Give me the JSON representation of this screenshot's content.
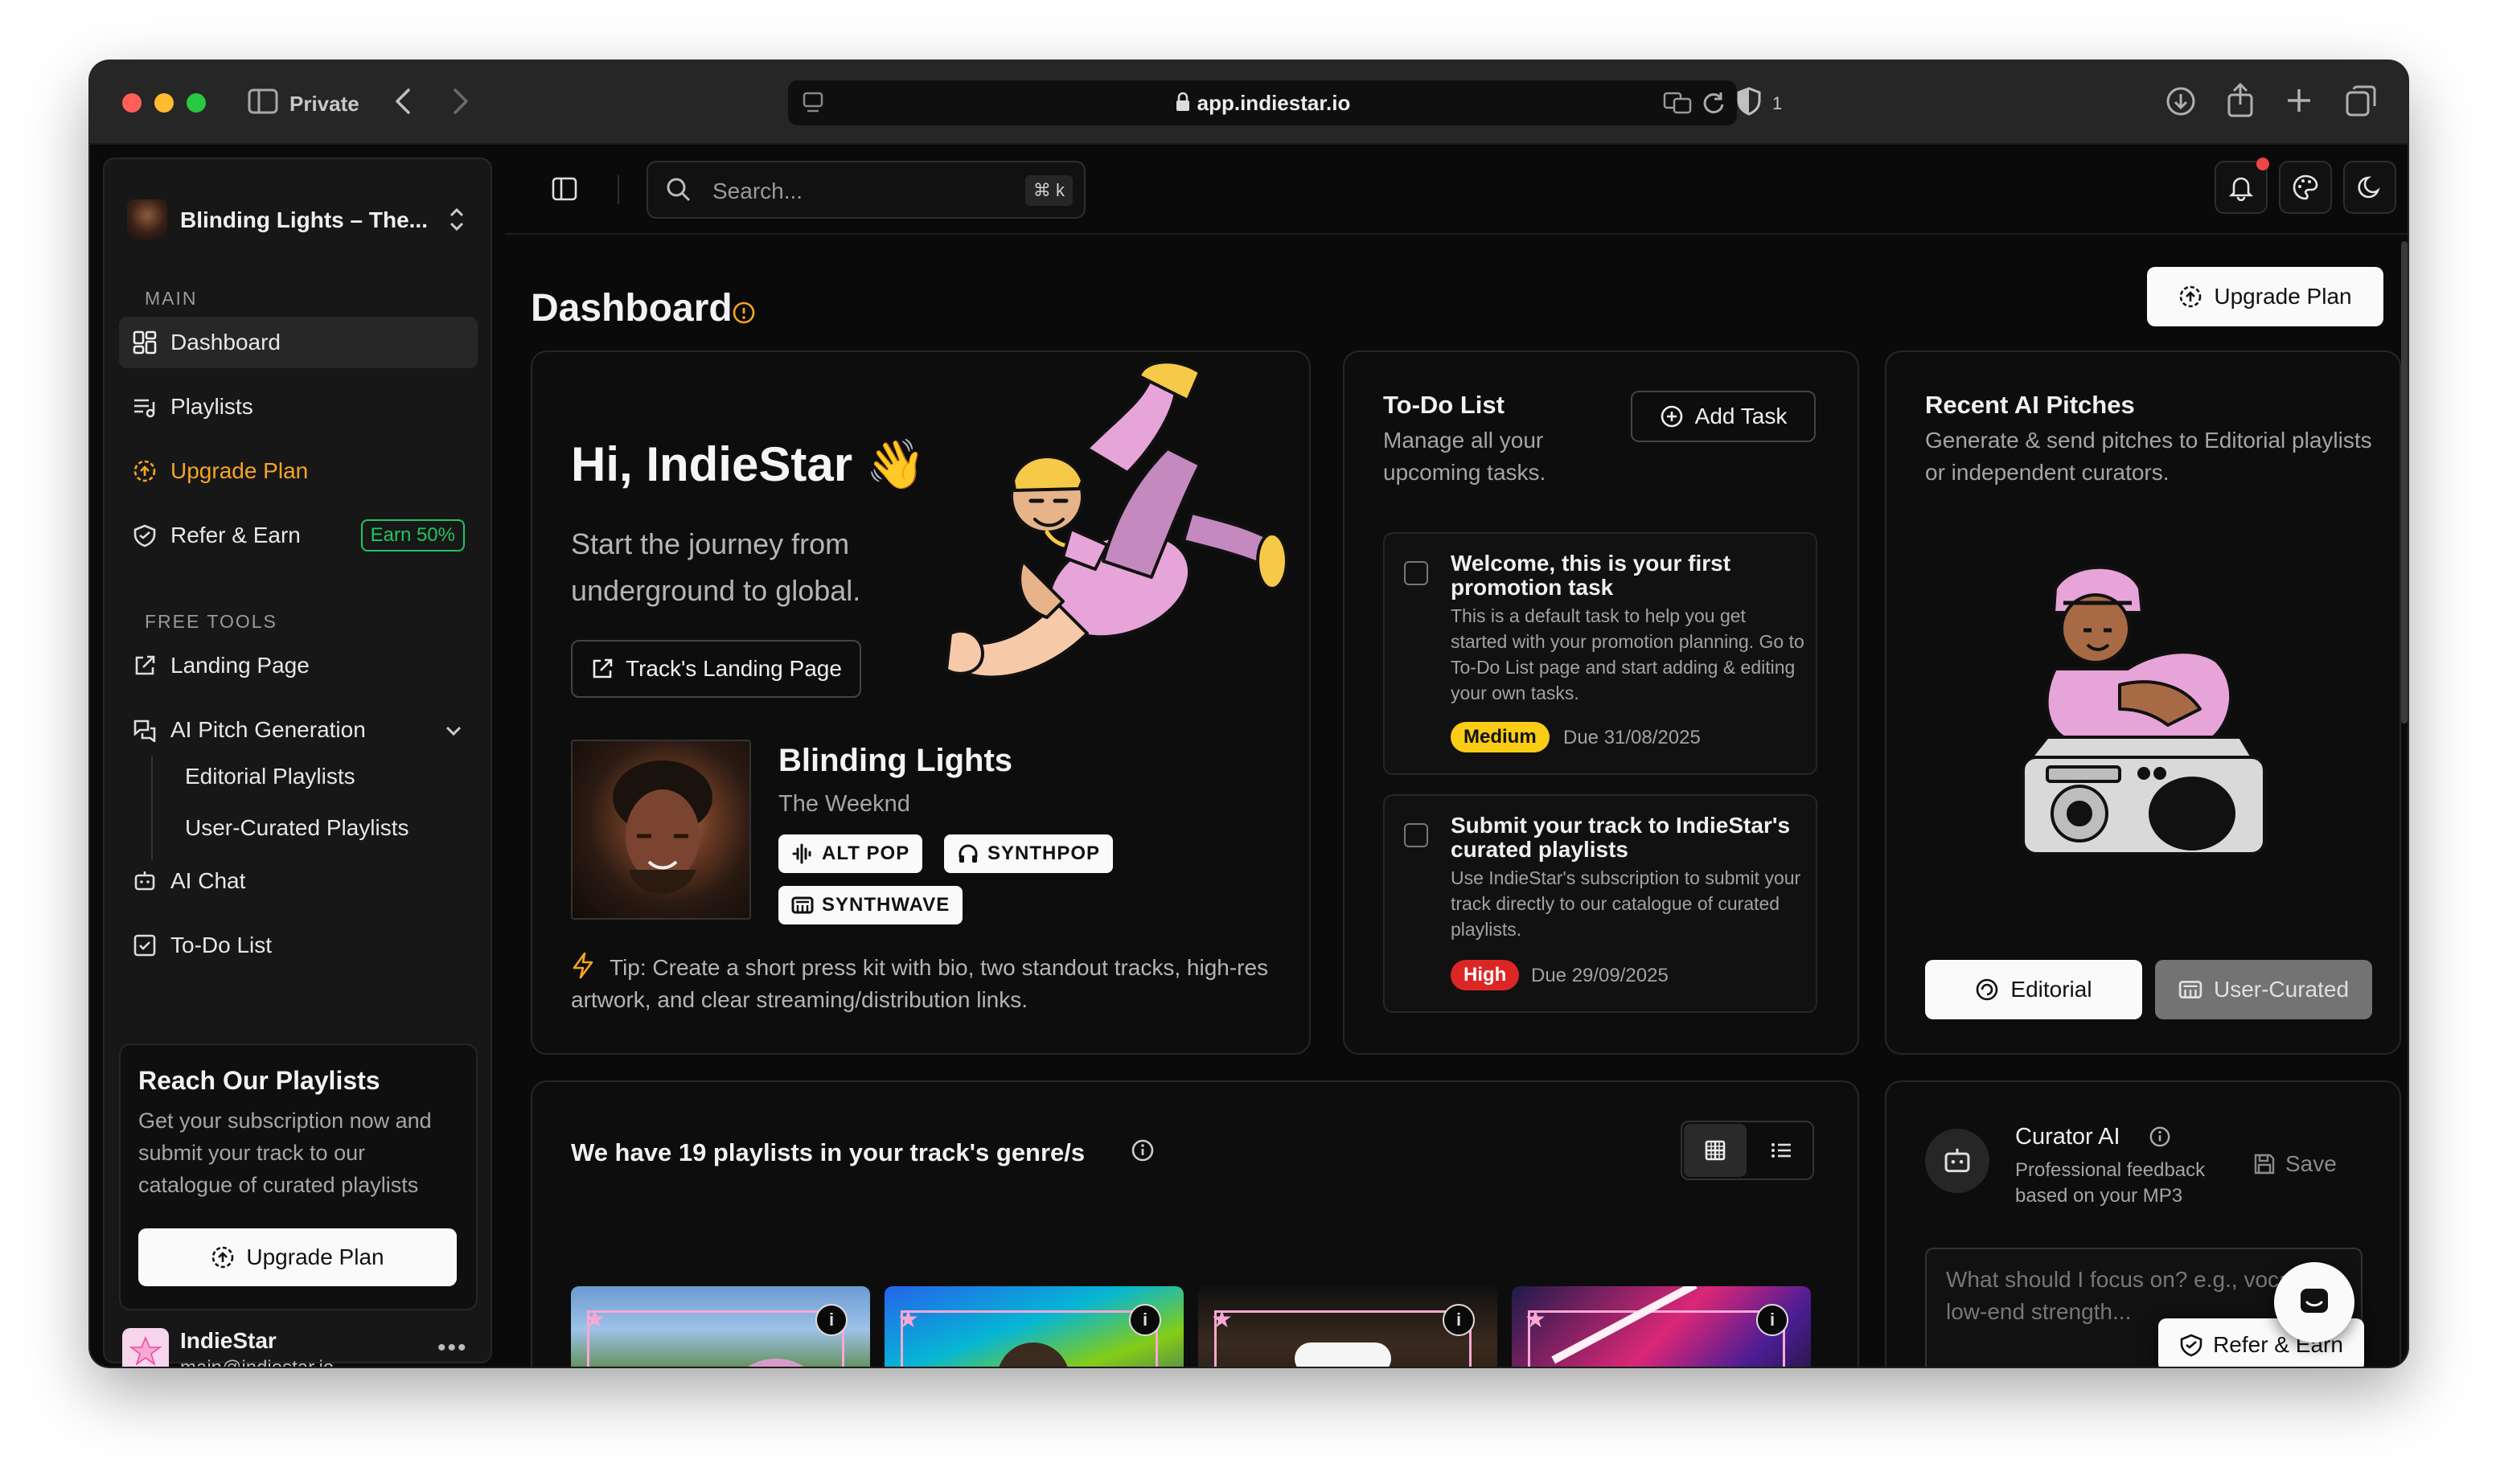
{
  "browser": {
    "private_label": "Private",
    "url": "app.indiestar.io",
    "shield_count": "1"
  },
  "sidebar": {
    "project_name": "Blinding Lights – The...",
    "section_main": "MAIN",
    "items_main": [
      {
        "label": "Dashboard",
        "icon": "dashboard-icon",
        "active": true
      },
      {
        "label": "Playlists",
        "icon": "playlist-icon"
      },
      {
        "label": "Upgrade Plan",
        "icon": "upgrade-icon",
        "accent": "#f5a524"
      },
      {
        "label": "Refer & Earn",
        "icon": "refer-icon",
        "badge": "Earn 50%"
      }
    ],
    "section_tools": "FREE TOOLS",
    "items_tools": [
      {
        "label": "Landing Page",
        "icon": "external-link-icon"
      },
      {
        "label": "AI Pitch Generation",
        "icon": "pitch-icon"
      },
      {
        "label": "AI Chat",
        "icon": "bot-icon"
      },
      {
        "label": "To-Do List",
        "icon": "todo-icon"
      }
    ],
    "sub_items": [
      "Editorial Playlists",
      "User-Curated Playlists"
    ],
    "promo": {
      "title": "Reach Our Playlists",
      "text": "Get your subscription now and submit your track to our catalogue of curated playlists",
      "button": "Upgrade Plan"
    },
    "user": {
      "name": "IndieStar",
      "email": "main@indiestar.io"
    }
  },
  "topbar": {
    "search_placeholder": "Search...",
    "search_shortcut": "⌘ k",
    "notification_dot_color": "#ef4444"
  },
  "page": {
    "title": "Dashboard",
    "upgrade_button": "Upgrade Plan"
  },
  "hero": {
    "greeting": "Hi, IndieStar 👋",
    "tagline": "Start the journey from underground to global.",
    "landing_button": "Track's Landing Page",
    "track_title": "Blinding Lights",
    "artist": "The Weeknd",
    "genres": [
      "ALT POP",
      "SYNTHPOP",
      "SYNTHWAVE"
    ],
    "tip": "Tip: Create a short press kit with bio, two standout tracks, high-res artwork, and clear streaming/distribution links."
  },
  "todo": {
    "title": "To-Do List",
    "subtitle": "Manage all your upcoming tasks.",
    "add_button": "Add Task",
    "tasks": [
      {
        "title": "Welcome, this is your first promotion task",
        "desc": "This is a default task to help you get started with your promotion planning. Go to To-Do List page and start adding & editing your own tasks.",
        "priority": "Medium",
        "priority_color": "#facc15",
        "due": "Due 31/08/2025"
      },
      {
        "title": "Submit your track to IndieStar's curated playlists",
        "desc": "Use IndieStar's subscription to submit your track directly to our catalogue of curated playlists.",
        "priority": "High",
        "priority_color": "#dc2626",
        "due": "Due 29/09/2025"
      }
    ]
  },
  "pitches": {
    "title": "Recent AI Pitches",
    "subtitle": "Generate & send pitches to Editorial playlists or independent curators.",
    "editorial_button": "Editorial",
    "curated_button": "User-Curated"
  },
  "playlists_section": {
    "title": "We have 19 playlists in your track's genre/s",
    "thumbs": [
      "playlist-1",
      "playlist-2",
      "playlist-3",
      "playlist-4"
    ]
  },
  "curator": {
    "title": "Curator AI",
    "subtitle": "Professional feedback based on your MP3",
    "save": "Save",
    "placeholder": "What should I focus on? e.g., vocal mix, low-end strength..."
  },
  "refer_float": "Refer & Earn"
}
